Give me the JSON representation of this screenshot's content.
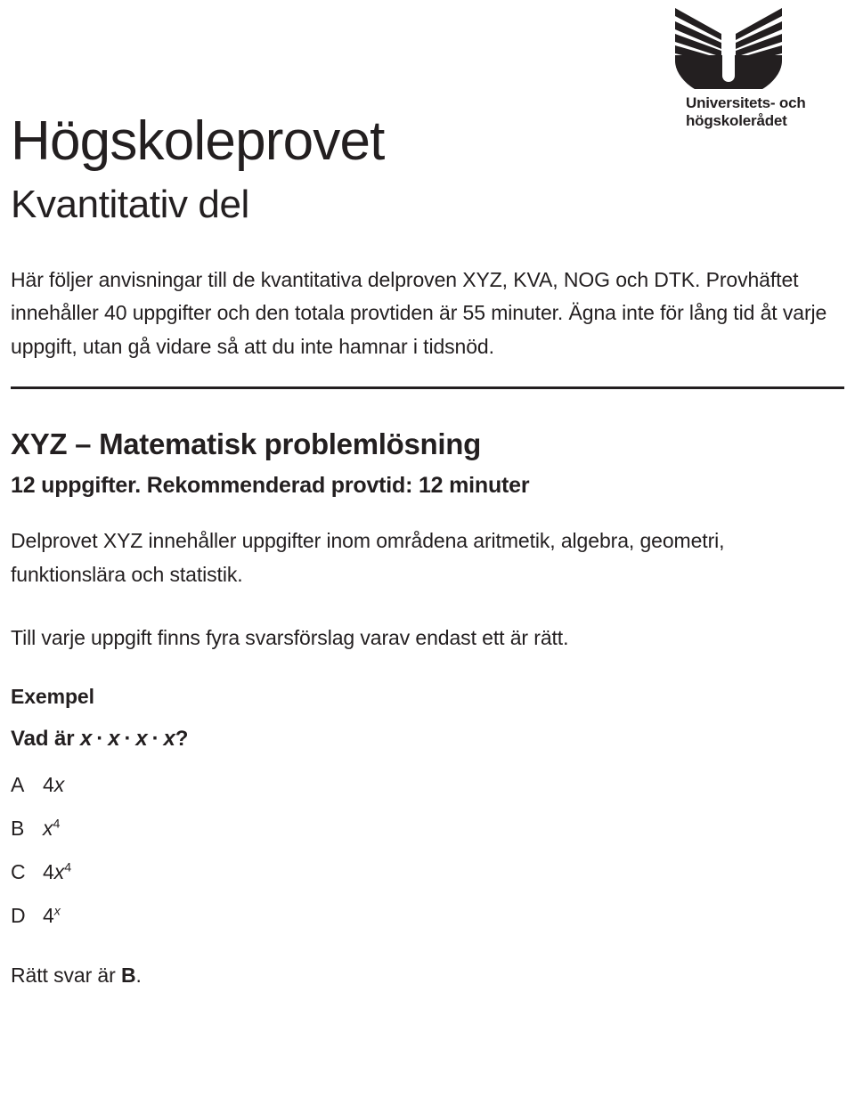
{
  "logo": {
    "mark_name": "uhr-open-book-u-logo",
    "line1": "Universitets- och",
    "line2": "högskolerådet"
  },
  "title": {
    "main": "Högskoleprovet",
    "sub": "Kvantitativ del"
  },
  "intro": {
    "text": "Här följer anvisningar till de kvantitativa delproven XYZ, KVA, NOG och DTK. Provhäftet innehåller 40 uppgifter och den totala provtiden är 55 minuter. Ägna inte för lång tid åt varje uppgift, utan gå vidare så att du inte hamnar i tidsnöd."
  },
  "section": {
    "heading": "XYZ – Matematisk problemlösning",
    "subheading": "12 uppgifter. Rekommenderad provtid: 12 minuter",
    "description": "Delprovet XYZ innehåller uppgifter inom områdena aritmetik, algebra, geometri, funktionslära och statistik.",
    "note": "Till varje uppgift finns fyra svarsförslag varav endast ett är rätt."
  },
  "example": {
    "label": "Exempel",
    "question_prefix": "Vad är",
    "question_var": "x",
    "question_operator": "·",
    "question_suffix": "?",
    "options": [
      {
        "letter": "A",
        "value": "4x",
        "base": "4",
        "italic": "x",
        "exponent": ""
      },
      {
        "letter": "B",
        "value": "x⁴",
        "base": "",
        "italic": "x",
        "exponent": "4"
      },
      {
        "letter": "C",
        "value": "4x⁴",
        "base": "4",
        "italic": "x",
        "exponent": "4"
      },
      {
        "letter": "D",
        "value": "4ˣ",
        "base": "4",
        "italic": "",
        "exponent": "x"
      }
    ],
    "answer_prefix": "Rätt svar är ",
    "answer_letter": "B",
    "answer_suffix": "."
  },
  "colors": {
    "text": "#231f20",
    "background": "#ffffff",
    "rule": "#231f20"
  }
}
